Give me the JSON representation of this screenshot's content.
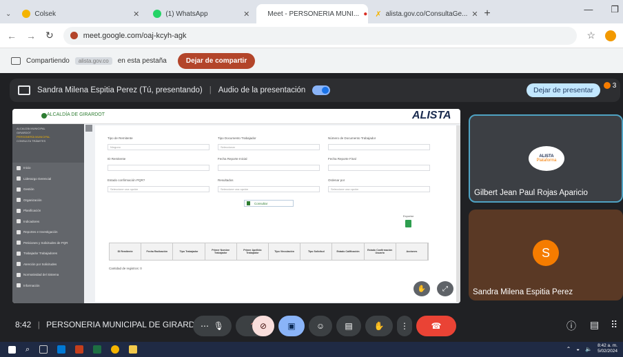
{
  "tabs": [
    {
      "label": "Colsek",
      "active": false,
      "icon": "colsek-icon",
      "color": "#f4b400"
    },
    {
      "label": "(1) WhatsApp",
      "active": false,
      "icon": "whatsapp-icon",
      "color": "#25d366"
    },
    {
      "label": "Meet - PERSONERIA MUNI...",
      "active": true,
      "icon": "meet-icon",
      "color": "#00832d"
    },
    {
      "label": "alista.gov.co/ConsultaGe...",
      "active": false,
      "icon": "alista-icon",
      "color": "#f4b400"
    }
  ],
  "address": {
    "url": "meet.google.com/oaj-kcyh-agk"
  },
  "sharebar": {
    "prefix": "Compartiendo",
    "chip": "alista.gov.co",
    "suffix": "en esta pestaña",
    "stop": "Dejar de compartir"
  },
  "presentation": {
    "presenter": "Sandra Milena Espitia Perez (Tú, presentando)",
    "audio_label": "Audio de la presentación",
    "stop": "Dejar de presentar",
    "participant_count": "3"
  },
  "shared_app": {
    "logo": "ALCALDÍA DE GIRARDOT",
    "brand": "ALISTA",
    "user_lines": [
      "ALCALDÍA MUNICIPAL",
      "GIRARDOT",
      "PERSONERÍA MUNICIPAL",
      "CONSULTA TRÁMITES"
    ],
    "menu": [
      "Inicio",
      "Liderazgo Gerencial",
      "Gestión",
      "Organización",
      "Planificación",
      "Indicadores",
      "Reportes e Investigación",
      "Peticiones y Solicitudes de PQR",
      "Trabajador Trabajadores",
      "Atención por Solicitudes",
      "Normatividad del Sistema",
      "Información"
    ],
    "fields": [
      {
        "label": "Tipo de Remitente",
        "value": "Ninguno"
      },
      {
        "label": "Tipo Documento Trabajador",
        "value": "Seleccionar"
      },
      {
        "label": "Número de Documento Trabajador",
        "value": ""
      },
      {
        "label": "ID Remitente",
        "value": ""
      },
      {
        "label": "Fecha Reporte Inicial",
        "value": ""
      },
      {
        "label": "Fecha Reporte Final",
        "value": ""
      },
      {
        "label": "Estado confirmación PQR?",
        "value": "Seleccione una opción"
      },
      {
        "label": "Resultados",
        "value": "Seleccione una opción"
      },
      {
        "label": "Ordenar por",
        "value": "Seleccione una opción"
      }
    ],
    "consult_button": "Consultar",
    "export_label": "Exportar",
    "table_headers": [
      "ID Remitente",
      "Fecha Radicación",
      "Tipo Trabajador",
      "Primer Nombre Trabajador",
      "Primer Apellido Trabajador",
      "Tipo Vinculación",
      "Tipo Solicitud",
      "Estado Calificación",
      "Estado Confirmación Usuario",
      "Acciones"
    ],
    "record_count": "Cantidad de registros: 0"
  },
  "participants": [
    {
      "name": "Gilbert Jean Paul Rojas Aparicio",
      "badge_text": "ALISTA",
      "badge_sub": "Plataforma"
    },
    {
      "name": "Sandra Milena Espitia Perez",
      "initial": "S"
    }
  ],
  "meeting": {
    "time": "8:42",
    "name": "PERSONERIA MUNICIPAL DE GIRARD..."
  },
  "taskbar": {
    "clock_time": "8:42 a. m.",
    "clock_date": "5/02/2024"
  },
  "colors": {
    "meet_bg": "#202124",
    "end_call": "#ea4335",
    "present_active": "#8ab4f8",
    "stop_share": "#b3452a",
    "avatar": "#f57c00"
  }
}
